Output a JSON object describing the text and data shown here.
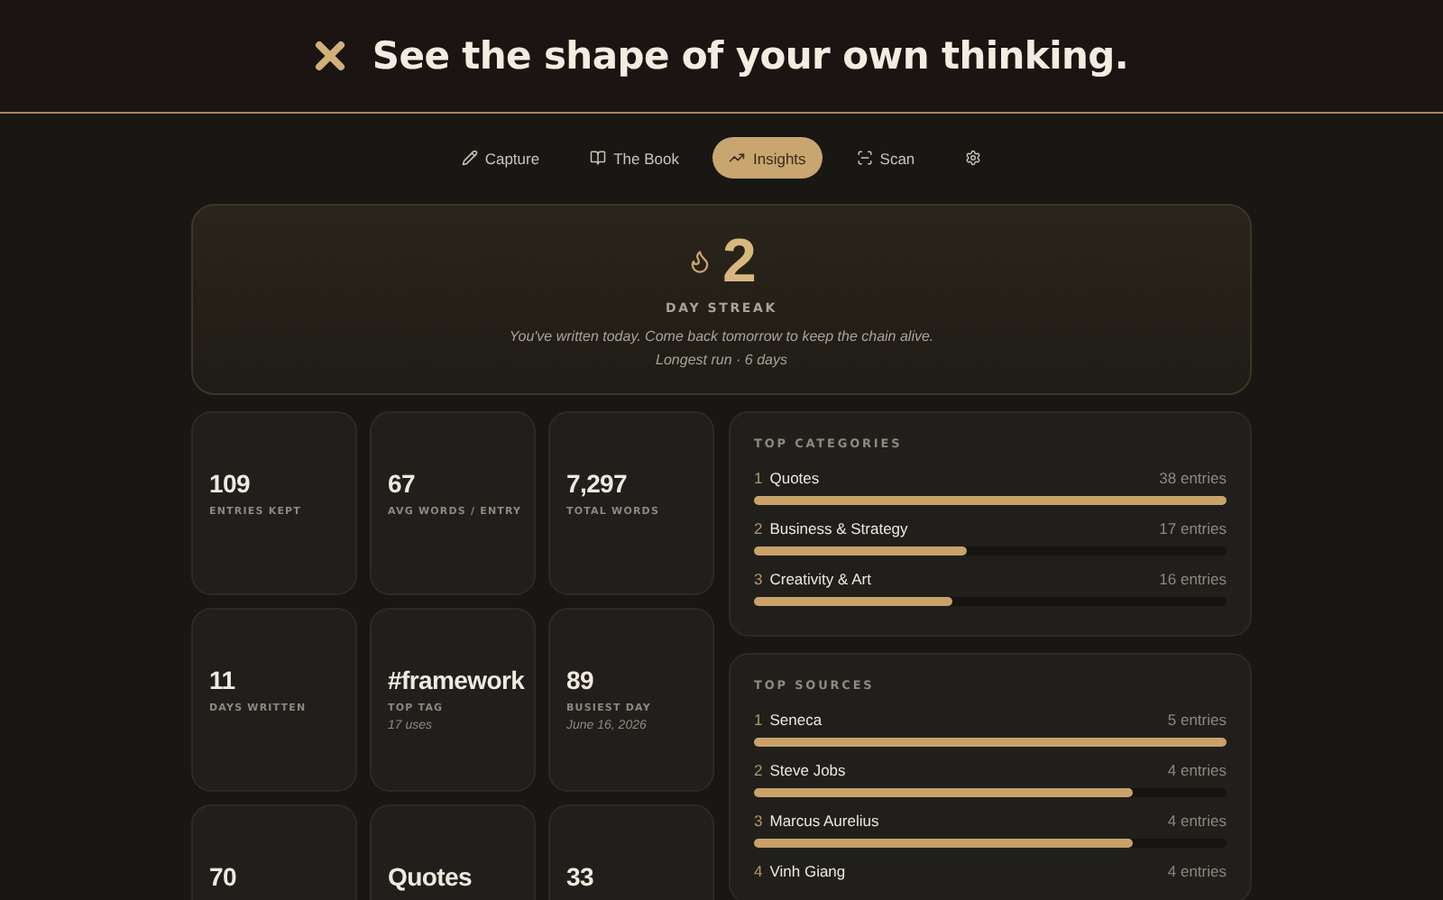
{
  "header": {
    "title": "See the shape of your own thinking."
  },
  "nav": [
    {
      "label": "Capture",
      "selected": false
    },
    {
      "label": "The Book",
      "selected": false
    },
    {
      "label": "Insights",
      "selected": true
    },
    {
      "label": "Scan",
      "selected": false
    },
    {
      "selected": false
    }
  ],
  "streak": {
    "value": "2",
    "label": "DAY STREAK",
    "message": "You've written today. Come back tomorrow to keep the chain alive.",
    "longest": "Longest run · 6 days"
  },
  "stats": [
    {
      "value": "109",
      "label": "ENTRIES KEPT"
    },
    {
      "value": "67",
      "label": "AVG WORDS / ENTRY"
    },
    {
      "value": "7,297",
      "label": "TOTAL WORDS"
    },
    {
      "value": "11",
      "label": "DAYS WRITTEN"
    },
    {
      "value": "#framework",
      "label": "TOP TAG",
      "sub": "17 uses"
    },
    {
      "value": "89",
      "label": "BUSIEST DAY",
      "sub": "June 16, 2026"
    },
    {
      "value": "70"
    },
    {
      "value": "Quotes"
    },
    {
      "value": "33"
    }
  ],
  "top_categories": {
    "title": "TOP CATEGORIES",
    "items": [
      {
        "rank": "1",
        "name": "Quotes",
        "count": "38 entries",
        "level": 1
      },
      {
        "rank": "2",
        "name": "Business & Strategy",
        "count": "17 entries",
        "level": 0.45
      },
      {
        "rank": "3",
        "name": "Creativity & Art",
        "count": "16 entries",
        "level": 0.42
      }
    ]
  },
  "top_sources": {
    "title": "TOP SOURCES",
    "items": [
      {
        "rank": "1",
        "name": "Seneca",
        "count": "5 entries",
        "level": 1
      },
      {
        "rank": "2",
        "name": "Steve Jobs",
        "count": "4 entries",
        "level": 0.8
      },
      {
        "rank": "3",
        "name": "Marcus Aurelius",
        "count": "4 entries",
        "level": 0.8
      },
      {
        "rank": "4",
        "name": "Vinh Giang",
        "count": "4 entries"
      }
    ]
  }
}
